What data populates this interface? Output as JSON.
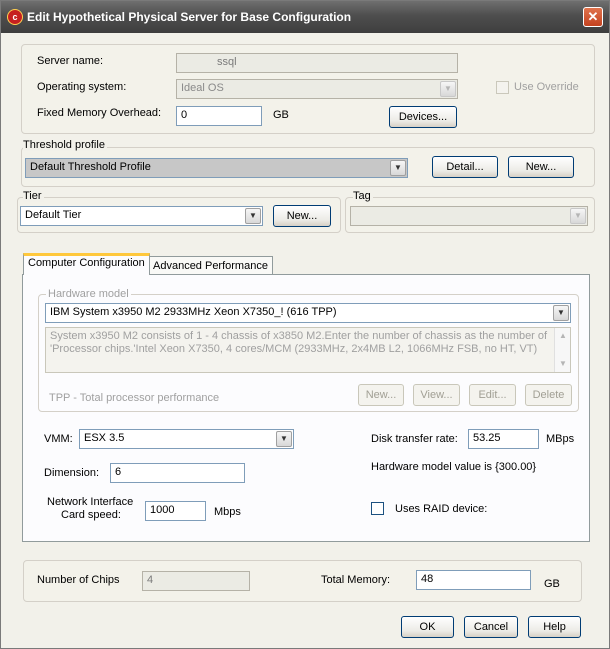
{
  "window": {
    "title": "Edit Hypothetical Physical Server for Base Configuration",
    "close": "✕"
  },
  "server": {
    "name_label": "Server name:",
    "name_value": "ssql",
    "os_label": "Operating system:",
    "os_value": "Ideal OS",
    "use_override": "Use Override",
    "mem_label": "Fixed Memory Overhead:",
    "mem_value": "0",
    "mem_unit": "GB",
    "devices_button": "Devices..."
  },
  "threshold": {
    "legend": "Threshold profile",
    "value": "Default Threshold Profile",
    "detail_button": "Detail...",
    "new_button": "New..."
  },
  "tier": {
    "legend": "Tier",
    "value": "Default Tier",
    "new_button": "New..."
  },
  "tag": {
    "legend": "Tag",
    "value": ""
  },
  "tabs": [
    {
      "label": "Computer Configuration",
      "active": true
    },
    {
      "label": "Advanced Performance",
      "active": false
    }
  ],
  "hardware": {
    "legend": "Hardware model",
    "value": "IBM System x3950 M2 2933MHz Xeon X7350_! (616 TPP)",
    "description": "System x3950 M2 consists of 1 - 4 chassis of x3850 M2.Enter the number of chassis as the number of 'Processor chips.'Intel Xeon X7350, 4 cores/MCM (2933MHz, 2x4MB L2, 1066MHz FSB, no HT, VT)",
    "tpp_note": "TPP - Total processor performance",
    "buttons": [
      "New...",
      "View...",
      "Edit...",
      "Delete"
    ]
  },
  "config": {
    "vmm_label": "VMM:",
    "vmm_value": "ESX 3.5",
    "disk_label": "Disk transfer rate:",
    "disk_value": "53.25",
    "disk_unit": "MBps",
    "hw_value_text": "Hardware model value is {300.00}",
    "dimension_label": "Dimension:",
    "dimension_value": "6",
    "nic_label_1": "Network Interface",
    "nic_label_2": "Card speed:",
    "nic_value": "1000",
    "nic_unit": "Mbps",
    "raid_label": "Uses RAID device:",
    "raid_checked": false
  },
  "summary": {
    "chips_label": "Number of Chips",
    "chips_value": "4",
    "mem_label": "Total Memory:",
    "mem_value": "48",
    "mem_unit": "GB"
  },
  "footer": {
    "ok": "OK",
    "cancel": "Cancel",
    "help": "Help"
  }
}
